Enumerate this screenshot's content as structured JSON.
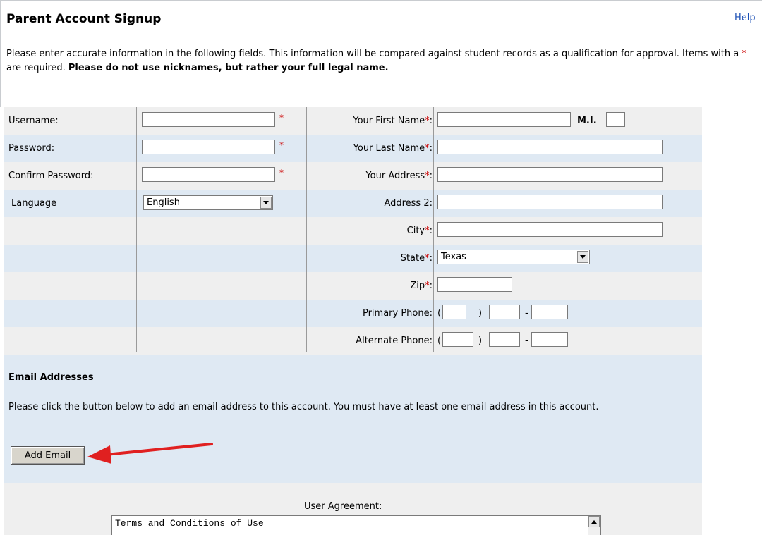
{
  "page": {
    "title": "Parent Account Signup",
    "help_label": "Help",
    "intro_part1": "Please enter accurate information in the following fields.  This information will be compared against student records as a qualification for approval.  Items with a ",
    "intro_star": "*",
    "intro_part2": " are required.  ",
    "intro_bold": "Please do not use nicknames, but rather your full legal name."
  },
  "form": {
    "left": {
      "username_label": "Username:",
      "password_label": "Password:",
      "confirm_label": "Confirm Password:",
      "language_label": "Language",
      "language_value": "English"
    },
    "right": {
      "first_name_label": "Your First Name",
      "mi_label": "M.I.",
      "last_name_label": "Your Last Name",
      "address_label": "Your Address",
      "address2_label": "Address 2:",
      "city_label": "City",
      "state_label": "State",
      "state_value": "Texas",
      "zip_label": "Zip",
      "primary_phone_label": "Primary Phone:",
      "alternate_phone_label": "Alternate Phone:"
    },
    "required_mark": "*",
    "colon": ":",
    "open_paren": "(",
    "close_paren": ")",
    "dash": "-"
  },
  "email": {
    "heading": "Email Addresses",
    "instructions": "Please click the button below to add an email address to this account. You must have at least one email address in this account.",
    "add_button": "Add Email"
  },
  "agreement": {
    "label": "User Agreement:",
    "text": "Terms and Conditions of Use"
  },
  "colors": {
    "required": "#cc0000",
    "link": "#1b4fb5",
    "row_gray": "#efefef",
    "row_blue": "#dfe9f3",
    "annotation_arrow": "#e02020"
  },
  "icons": {
    "dropdown": "chevron-down-icon",
    "scroll_up": "scroll-up-icon",
    "annotation": "red-arrow-icon"
  }
}
